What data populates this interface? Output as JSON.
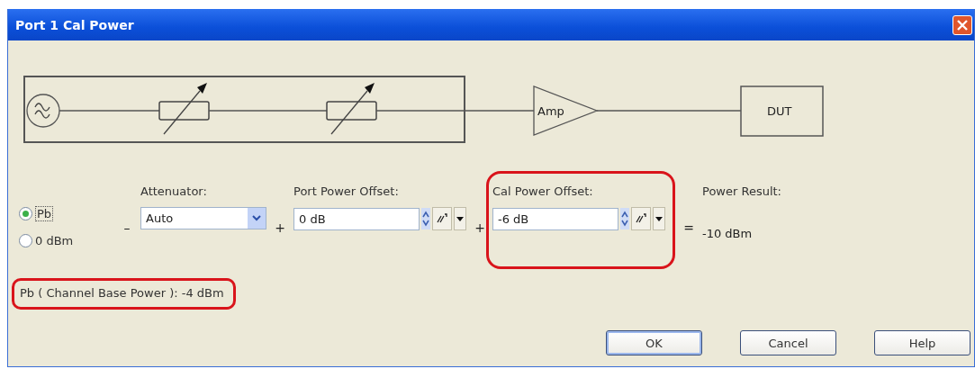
{
  "window": {
    "title": "Port 1 Cal Power"
  },
  "diagram": {
    "amp_label": "Amp",
    "dut_label": "DUT"
  },
  "base_options": [
    {
      "label": "Pb",
      "selected": true
    },
    {
      "label": "0 dBm",
      "selected": false
    }
  ],
  "operators": [
    "–",
    "+",
    "+",
    "="
  ],
  "attenuator": {
    "label": "Attenuator:",
    "value": "Auto"
  },
  "port_power_offset": {
    "label": "Port Power Offset:",
    "value": "0 dB",
    "highlighted": false
  },
  "cal_power_offset": {
    "label": "Cal Power Offset:",
    "value": "-6 dB",
    "highlighted": true
  },
  "power_result": {
    "label": "Power Result:",
    "value": "-10 dBm"
  },
  "base_power_note": {
    "text": "Pb ( Channel Base Power ): -4 dBm",
    "highlighted": true
  },
  "buttons": [
    {
      "label": "OK",
      "default": true
    },
    {
      "label": "Cancel",
      "default": false
    },
    {
      "label": "Help",
      "default": false
    }
  ]
}
